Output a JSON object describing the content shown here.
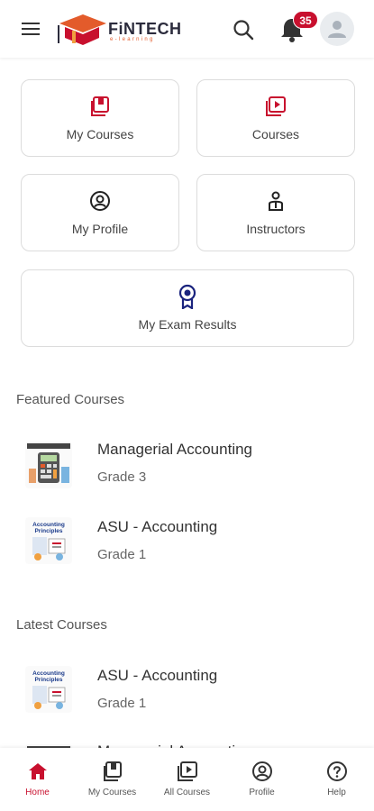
{
  "header": {
    "logo_text": "FiNTECH",
    "logo_sub": "e-learning",
    "notification_count": "35"
  },
  "tiles": [
    {
      "label": "My Courses",
      "icon": "book-icon"
    },
    {
      "label": "Courses",
      "icon": "video-library-icon"
    },
    {
      "label": "My Profile",
      "icon": "profile-icon"
    },
    {
      "label": "Instructors",
      "icon": "instructor-icon"
    },
    {
      "label": "My Exam Results",
      "icon": "award-icon"
    }
  ],
  "featured": {
    "title": "Featured Courses",
    "items": [
      {
        "title": "Managerial Accounting",
        "grade": "Grade 3"
      },
      {
        "title": "ASU - Accounting",
        "grade": "Grade 1"
      }
    ]
  },
  "latest": {
    "title": "Latest Courses",
    "items": [
      {
        "title": "ASU - Accounting",
        "grade": "Grade 1"
      },
      {
        "title": "Managerial Accounting",
        "grade": ""
      }
    ]
  },
  "bottom_nav": [
    {
      "label": "Home",
      "active": true
    },
    {
      "label": "My Courses",
      "active": false
    },
    {
      "label": "All Courses",
      "active": false
    },
    {
      "label": "Profile",
      "active": false
    },
    {
      "label": "Help",
      "active": false
    }
  ],
  "colors": {
    "accent": "#c8102e",
    "award": "#1a237e",
    "text": "#333333"
  }
}
